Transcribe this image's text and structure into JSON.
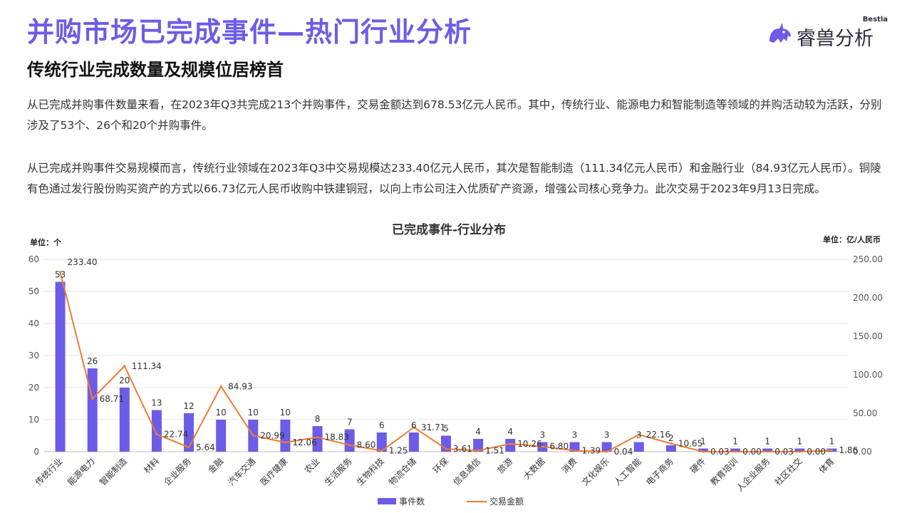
{
  "header": {
    "title": "并购市场已完成事件—热门行业分析",
    "subtitle": "传统行业完成数量及规模位居榜首"
  },
  "logo": {
    "brand_en": "Bestla",
    "brand_cn": "睿兽分析"
  },
  "paragraphs": [
    "从已完成并购事件数量来看，在2023年Q3共完成213个并购事件，交易金额达到678.53亿元人民币。其中，传统行业、能源电力和智能制造等领域的并购活动较为活跃，分别涉及了53个、26个和20个并购事件。",
    "从已完成并购事件交易规模而言，传统行业领域在2023年Q3中交易规模达233.40亿元人民币，其次是智能制造（111.34亿元人民币）和金融行业（84.93亿元人民币）。铜陵有色通过发行股份购买资产的方式以66.73亿元人民币收购中铁建铜冠，以向上市公司注入优质矿产资源，增强公司核心竞争力。此次交易于2023年9月13日完成。"
  ],
  "chart_data": {
    "type": "bar",
    "title": "已完成事件-行业分布",
    "ylabel": "单位：个",
    "y2label": "单位：亿/人民币",
    "ylim": [
      0,
      60
    ],
    "yticks": [
      0,
      10,
      20,
      30,
      40,
      50,
      60
    ],
    "y2lim": [
      0,
      250
    ],
    "y2ticks": [
      "0.00",
      "50.00",
      "100.00",
      "150.00",
      "200.00",
      "250.00"
    ],
    "legend_position": "bottom",
    "categories": [
      "传统行业",
      "能源电力",
      "智能制造",
      "材料",
      "企业服务",
      "金融",
      "汽车交通",
      "医疗健康",
      "农业",
      "生活服务",
      "生物科技",
      "物流仓储",
      "环保",
      "信息通信",
      "旅游",
      "大数据",
      "消费",
      "文化娱乐",
      "人工智能",
      "电子商务",
      "硬件",
      "教育培训",
      "人企业服务",
      "社区社交",
      "体育"
    ],
    "series": [
      {
        "name": "事件数",
        "type": "bar",
        "axis": "left",
        "color": "#6c5ce7",
        "values": [
          53,
          26,
          20,
          13,
          12,
          10,
          10,
          10,
          8,
          7,
          6,
          6,
          5,
          4,
          4,
          3,
          3,
          3,
          3,
          2,
          1,
          1,
          1,
          1,
          1
        ],
        "labels": [
          "53",
          "26",
          "20",
          "13",
          "12",
          "10",
          "10",
          "10",
          "8",
          "7",
          "6",
          "6",
          "5",
          "4",
          "4",
          "3",
          "3",
          "3",
          "3",
          "2",
          "1",
          "1",
          "1",
          "1",
          "1"
        ]
      },
      {
        "name": "交易金额",
        "type": "line",
        "axis": "right",
        "color": "#ed7d31",
        "values": [
          233.4,
          68.71,
          111.34,
          22.74,
          5.64,
          84.93,
          20.99,
          12.06,
          18.83,
          8.6,
          1.25,
          31.71,
          3.61,
          1.51,
          10.26,
          6.8,
          1.39,
          0.04,
          22.16,
          10.65,
          0.03,
          0.0,
          0.03,
          0.0,
          1.86
        ],
        "labels": [
          "233.40",
          "68.71",
          "111.34",
          "22.74",
          "5.64",
          "84.93",
          "20.99",
          "12.06",
          "18.83",
          "8.60",
          "1.25",
          "31.71",
          "3.61",
          "1.51",
          "10.26",
          "6.80",
          "1.39",
          "0.04",
          "22.16",
          "10.65",
          "0.03",
          "0.00",
          "0.03",
          "0.00",
          "1.86"
        ]
      }
    ]
  }
}
